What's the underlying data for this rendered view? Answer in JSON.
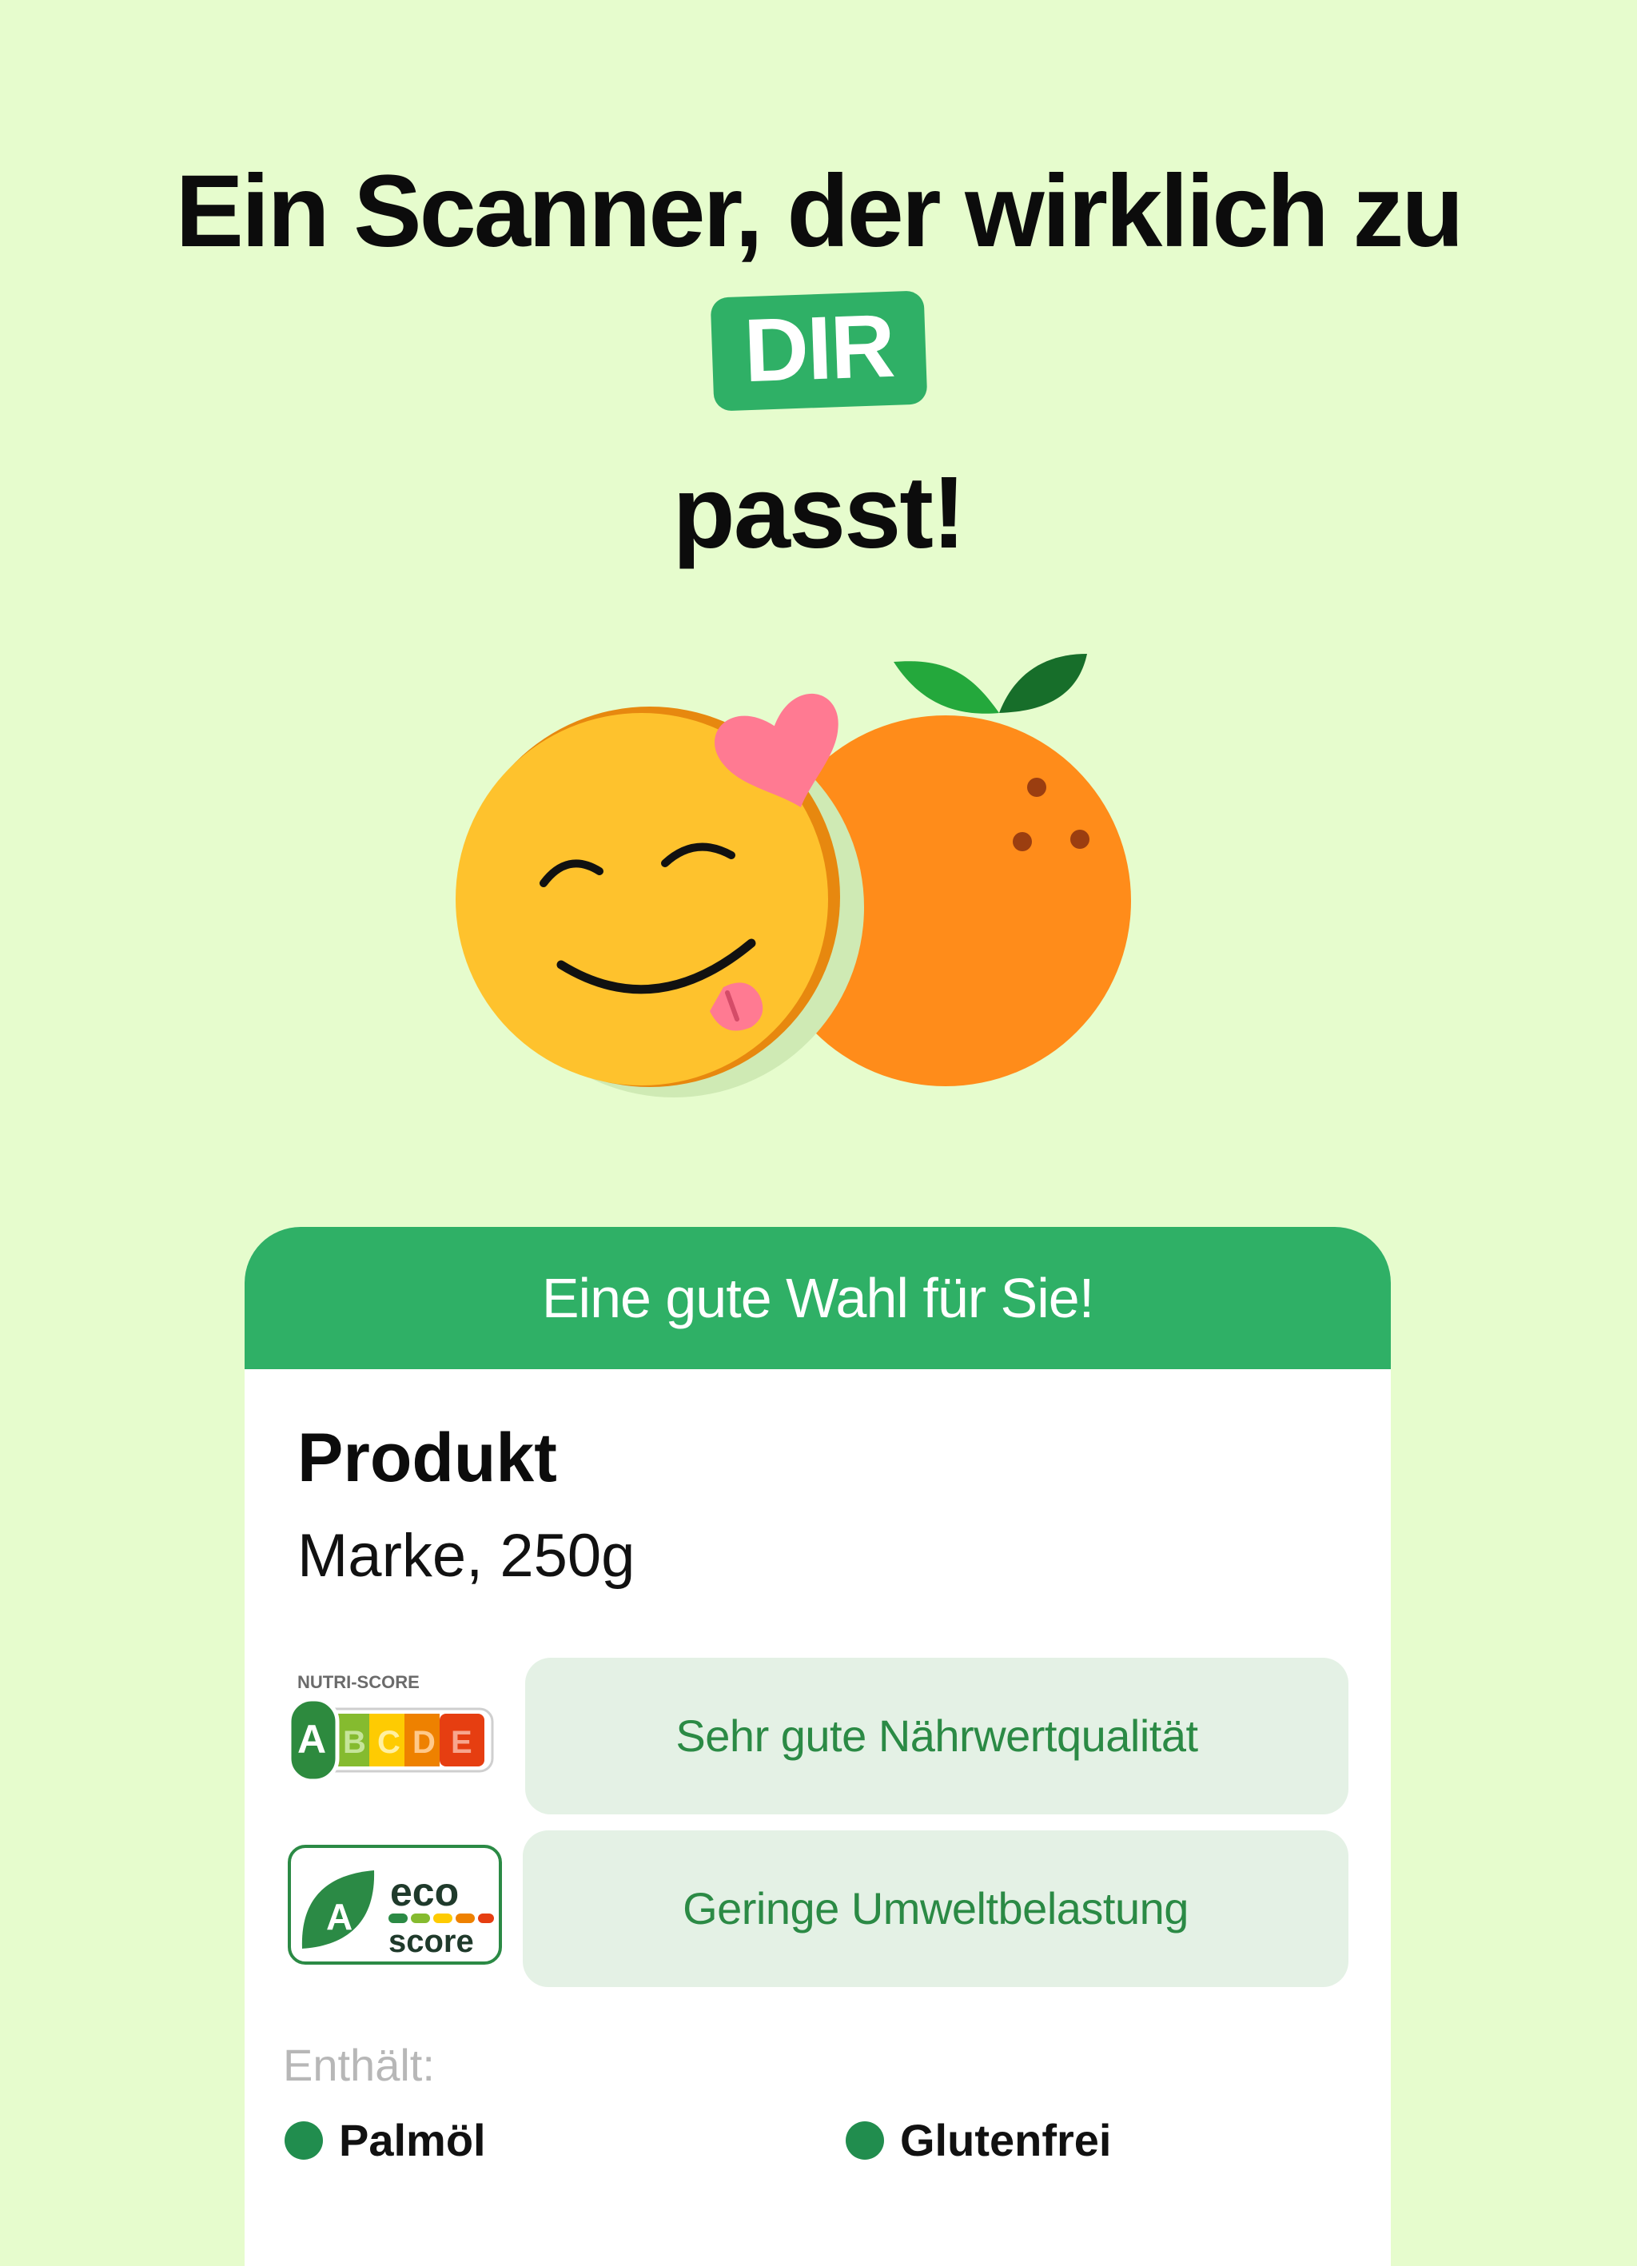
{
  "headline": {
    "line1": "Ein Scanner, der wirklich zu",
    "highlight": "DIR",
    "line2": "passt!"
  },
  "illustration": {
    "icons": [
      "smiley-face-icon",
      "orange-fruit-icon",
      "heart-icon"
    ]
  },
  "card": {
    "header": "Eine gute Wahl für Sie!",
    "product_name": "Produkt",
    "product_details": "Marke, 250g",
    "scores": [
      {
        "logo": "nutri-score-badge",
        "logo_title": "NUTRI-SCORE",
        "grades": [
          "A",
          "B",
          "C",
          "D",
          "E"
        ],
        "selected": "A",
        "label": "Sehr gute Nährwertqualität"
      },
      {
        "logo": "eco-score-badge",
        "logo_grade": "A",
        "logo_word1": "eco",
        "logo_word2": "score",
        "label": "Geringe Umweltbelastung"
      }
    ],
    "contains_label": "Enthält:",
    "tags": [
      {
        "label": "Palmöl",
        "dot_color": "#218d4e"
      },
      {
        "label": "Glutenfrei",
        "dot_color": "#218d4e"
      }
    ]
  },
  "colors": {
    "background": "#e6fccd",
    "accent_green": "#2fb066",
    "score_pill_bg": "#e4f1e5",
    "score_text": "#2b8a45"
  }
}
